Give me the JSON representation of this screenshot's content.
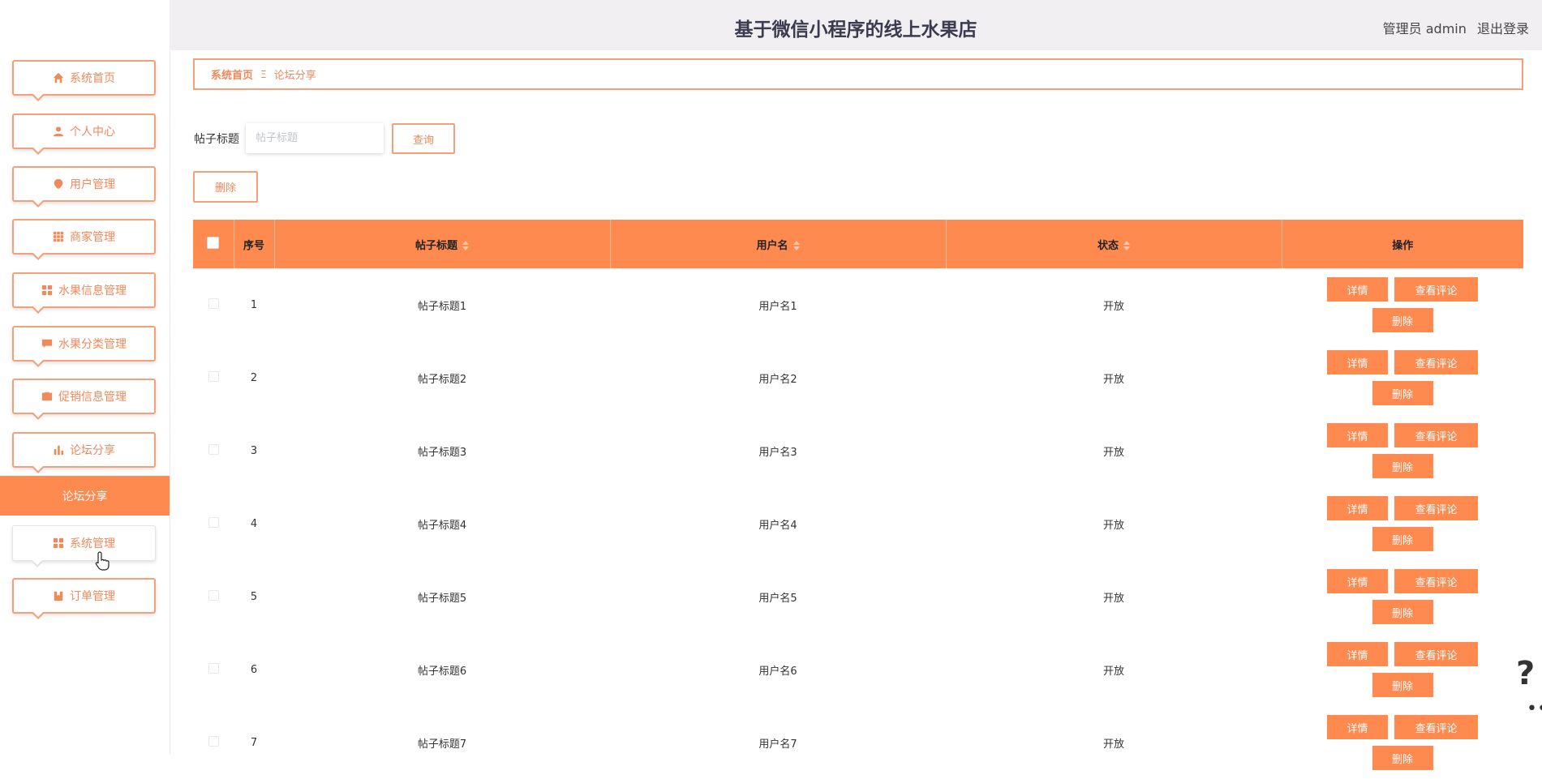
{
  "header": {
    "title": "基于微信小程序的线上水果店",
    "user_label": "管理员 admin",
    "logout": "退出登录"
  },
  "sidebar": {
    "items": [
      {
        "label": "系统首页",
        "icon": "home-icon"
      },
      {
        "label": "个人中心",
        "icon": "user-icon"
      },
      {
        "label": "用户管理",
        "icon": "pin-icon"
      },
      {
        "label": "商家管理",
        "icon": "grid-icon"
      },
      {
        "label": "水果信息管理",
        "icon": "apps-icon"
      },
      {
        "label": "水果分类管理",
        "icon": "chat-icon"
      },
      {
        "label": "促销信息管理",
        "icon": "briefcase-icon"
      },
      {
        "label": "论坛分享",
        "icon": "bar-chart-icon"
      },
      {
        "label": "系统管理",
        "icon": "apps-icon"
      },
      {
        "label": "订单管理",
        "icon": "book-icon"
      }
    ],
    "active_sub": "论坛分享"
  },
  "breadcrumb": {
    "home": "系统首页",
    "separator": "Ξ",
    "current": "论坛分享"
  },
  "search": {
    "label": "帖子标题",
    "placeholder": "帖子标题",
    "query_button": "查询"
  },
  "toolbar": {
    "delete_button": "删除"
  },
  "table": {
    "columns": [
      "序号",
      "帖子标题",
      "用户名",
      "状态",
      "操作"
    ],
    "rows": [
      {
        "index": "1",
        "title": "帖子标题1",
        "username": "用户名1",
        "status": "开放"
      },
      {
        "index": "2",
        "title": "帖子标题2",
        "username": "用户名2",
        "status": "开放"
      },
      {
        "index": "3",
        "title": "帖子标题3",
        "username": "用户名3",
        "status": "开放"
      },
      {
        "index": "4",
        "title": "帖子标题4",
        "username": "用户名4",
        "status": "开放"
      },
      {
        "index": "5",
        "title": "帖子标题5",
        "username": "用户名5",
        "status": "开放"
      },
      {
        "index": "6",
        "title": "帖子标题6",
        "username": "用户名6",
        "status": "开放"
      },
      {
        "index": "7",
        "title": "帖子标题7",
        "username": "用户名7",
        "status": "开放"
      }
    ],
    "actions": {
      "detail": "详情",
      "comments": "查看评论",
      "delete": "删除"
    }
  },
  "help": {
    "mark": "?",
    "dots": "••"
  },
  "colors": {
    "accent": "#ff8a50",
    "accent_border": "#f4a07a",
    "header_bg": "#f1eff2"
  }
}
